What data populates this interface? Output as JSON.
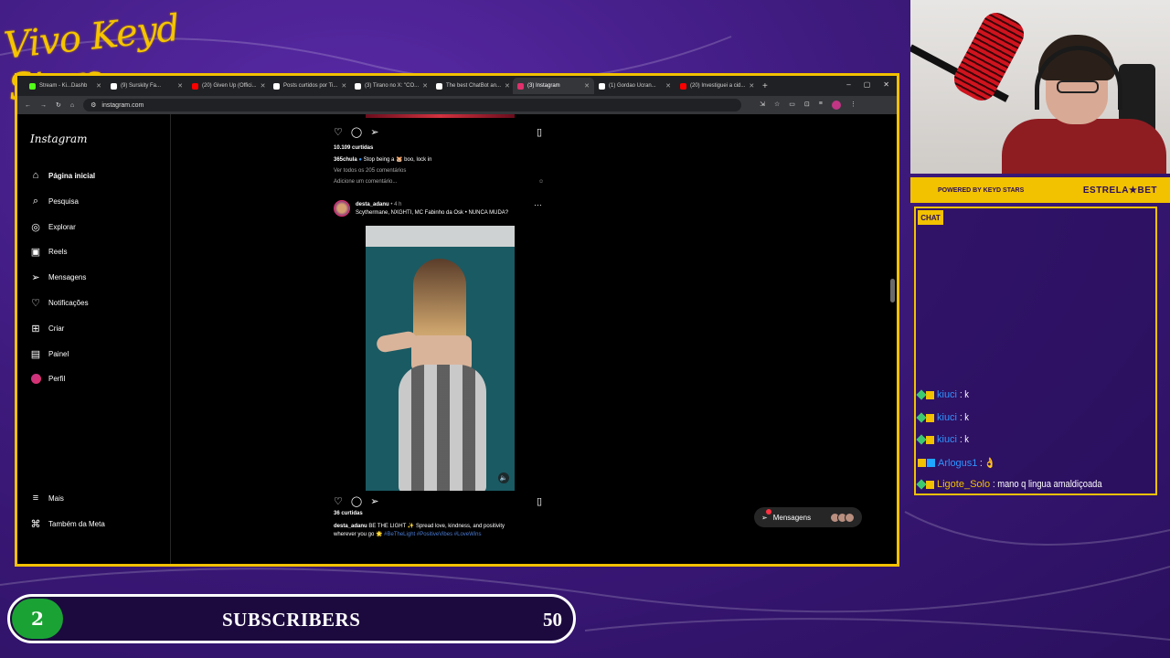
{
  "overlay": {
    "title": "Vivo Keyd Stars"
  },
  "browser": {
    "tabs": [
      {
        "label": "Stream - Ki...Dashb",
        "color": "#53fc18",
        "active": false
      },
      {
        "label": "(9) Surskity Fa...",
        "color": "#ffffff",
        "active": false
      },
      {
        "label": "(20) Given Up (Offici...",
        "color": "#ff0000",
        "active": false
      },
      {
        "label": "Posts curtidos por Ti...",
        "color": "#ffffff",
        "active": false
      },
      {
        "label": "(3) Tirano no X: \"CO...",
        "color": "#ffffff",
        "active": false
      },
      {
        "label": "The best ChatBot an...",
        "color": "#ffffff",
        "active": false
      },
      {
        "label": "(3) Instagram",
        "color": "#e1306c",
        "active": true
      },
      {
        "label": "(1) Gordao Ucran...",
        "color": "#ffffff",
        "active": false
      },
      {
        "label": "(20) Investiguei a cid...",
        "color": "#ff0000",
        "active": false
      }
    ],
    "url": "instagram.com"
  },
  "instagram": {
    "logo": "Instagram",
    "nav": [
      {
        "label": "Página inicial",
        "icon": "home-icon",
        "glyph": "⌂"
      },
      {
        "label": "Pesquisa",
        "icon": "search-icon",
        "glyph": "⌕"
      },
      {
        "label": "Explorar",
        "icon": "compass-icon",
        "glyph": "◎"
      },
      {
        "label": "Reels",
        "icon": "reels-icon",
        "glyph": "▣"
      },
      {
        "label": "Mensagens",
        "icon": "messenger-icon",
        "glyph": "➢"
      },
      {
        "label": "Notificações",
        "icon": "heart-icon",
        "glyph": "♡"
      },
      {
        "label": "Criar",
        "icon": "create-icon",
        "glyph": "⊞"
      },
      {
        "label": "Painel",
        "icon": "dashboard-icon",
        "glyph": "▤"
      },
      {
        "label": "Perfil",
        "icon": "profile-icon",
        "glyph": ""
      }
    ],
    "more": "Mais",
    "meta": "Também da Meta",
    "prev_post": {
      "likes": "10.109 curtidas",
      "user": "365chula",
      "caption": "Stop being a 🐹 boo, lock in",
      "comments": "Ver todos os 205 comentários",
      "add_comment": "Adicione um comentário..."
    },
    "post": {
      "user": "desta_adanu",
      "time": "• 4 h",
      "audio": "Scythermane, NXGHTI, MC Fabinho da Osk • NUNCA MUDA?",
      "likes": "36 curtidas",
      "caption_user": "desta_adanu",
      "caption": "BE THE LIGHT ✨ Spread love, kindness, and positivity",
      "caption2": "wherever you go 🌟",
      "hashtags": "#BeTheLight #PositiveVibes #LoveWins"
    },
    "messages_pill": "Mensagens"
  },
  "sponsor": {
    "left": "POWERED BY  KEYD STARS",
    "right": "ESTRELA★BET"
  },
  "chat": {
    "label": "CHAT",
    "messages": [
      {
        "user": "kiuci",
        "text": ": k"
      },
      {
        "user": "kiuci",
        "text": ": k"
      },
      {
        "user": "kiuci",
        "text": ": k"
      },
      {
        "user": "Arlogus1",
        "text": ": 👌"
      },
      {
        "user": "Ligote_Solo",
        "text": ": mano q lingua amaldiçoada"
      }
    ]
  },
  "subscribers": {
    "count": "2",
    "label": "SUBSCRIBERS",
    "goal": "50"
  }
}
